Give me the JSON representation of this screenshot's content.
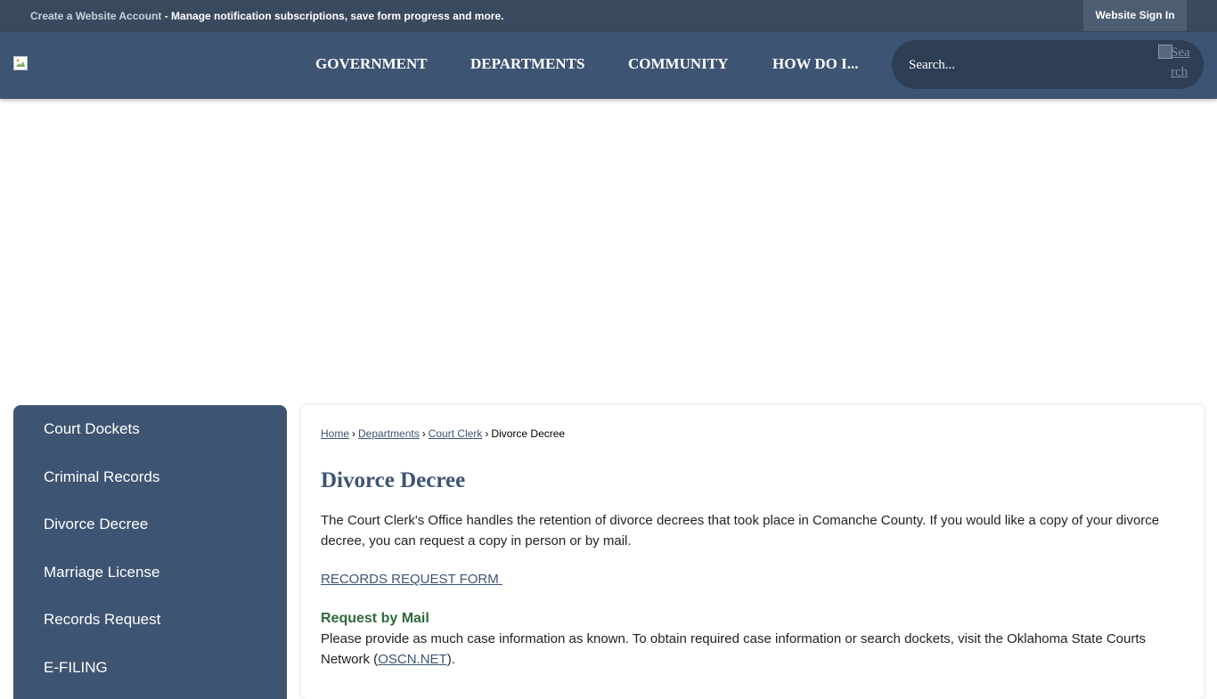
{
  "topbar": {
    "create_account": "Create a Website Account",
    "description": " - Manage notification subscriptions, save form progress and more.",
    "sign_in": "Website Sign In"
  },
  "nav": {
    "items": [
      "GOVERNMENT",
      "DEPARTMENTS",
      "COMMUNITY",
      "HOW DO I..."
    ]
  },
  "search": {
    "placeholder": "Search...",
    "button_alt_line1": "Sea",
    "button_alt_line2": "rch"
  },
  "sidebar": {
    "items": [
      "Court Dockets",
      "Criminal Records",
      "Divorce Decree",
      "Marriage License",
      "Records Request",
      "E-FILING"
    ]
  },
  "breadcrumb": {
    "home": "Home",
    "departments": "Departments",
    "court_clerk": "Court Clerk",
    "current": "Divorce Decree",
    "separator": "›"
  },
  "main": {
    "title": "Divorce Decree",
    "intro": "The Court Clerk's Office handles the retention of divorce decrees that took place in Comanche County. If you would like a copy of your divorce decree, you can request a copy in person or by mail.",
    "records_link": "RECORDS REQUEST FORM ",
    "mail_heading": "Request by Mail",
    "mail_text_before": "Please provide as much case information as known. To obtain required case information or search dockets, visit the Oklahoma State Courts Network (",
    "mail_link": "OSCN.NET",
    "mail_text_after": ")."
  },
  "colors": {
    "topbar": "#3a4a5e",
    "navbar": "#3e5473",
    "search": "#2d3e55",
    "accent_green": "#2f6a3a"
  }
}
